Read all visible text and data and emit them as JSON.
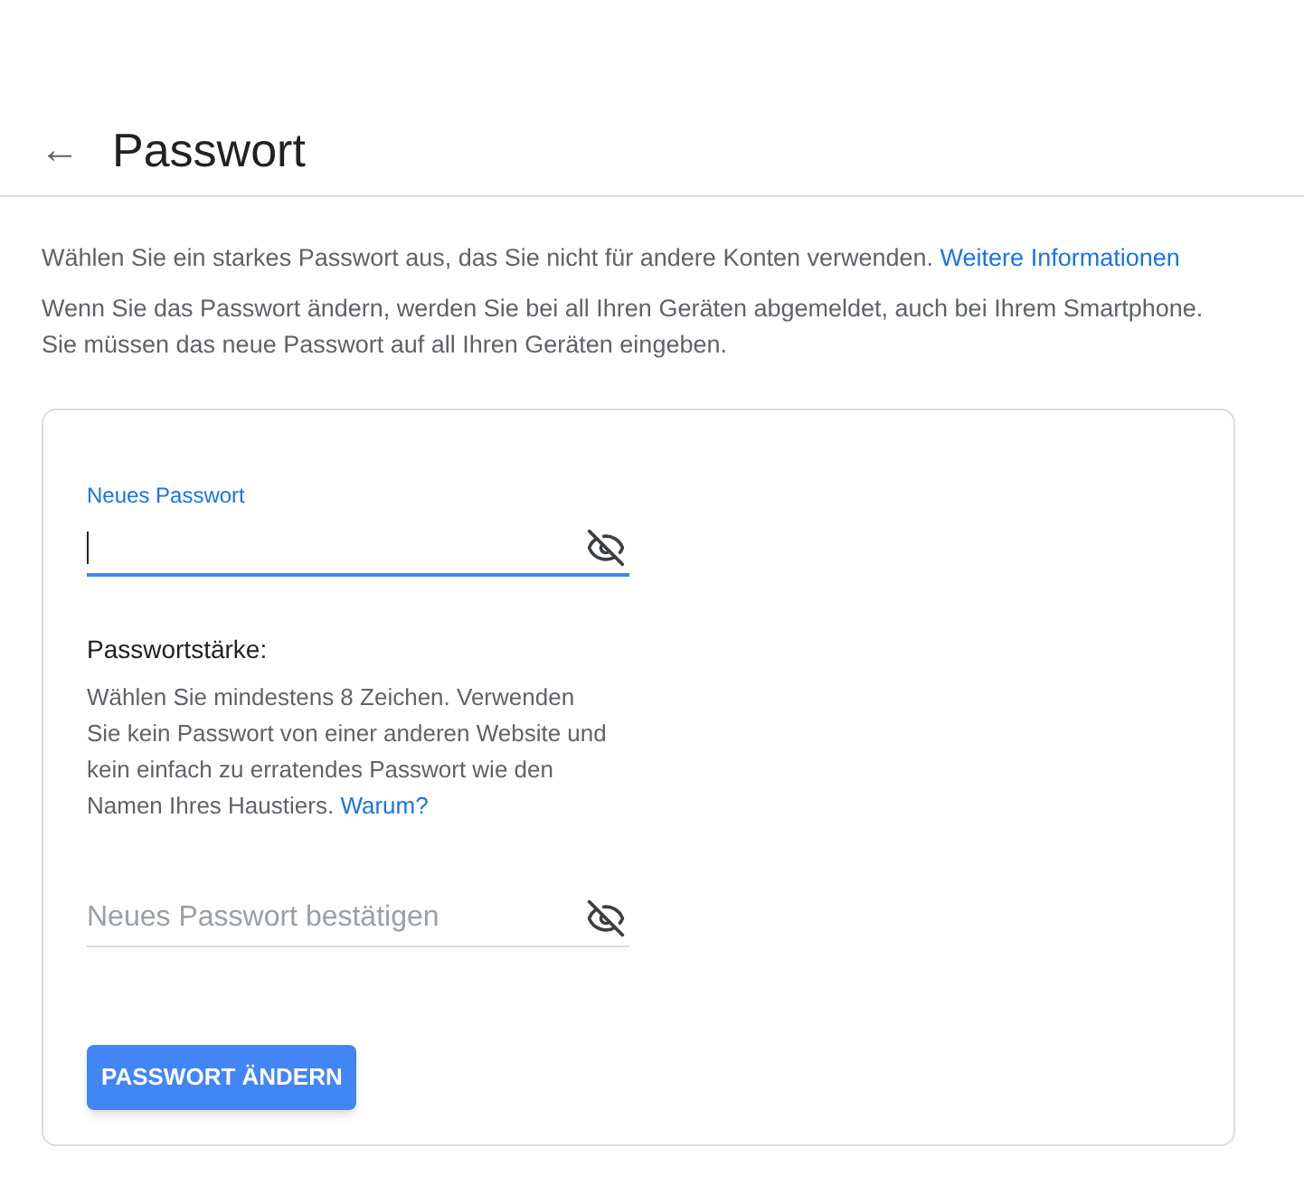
{
  "header": {
    "back": "←",
    "title": "Passwort"
  },
  "intro": [
    {
      "text": "Wählen Sie ein starkes Passwort aus, das Sie nicht für andere Konten verwenden.",
      "link": "Weitere Informationen"
    },
    {
      "text": "Wenn Sie das Passwort ändern, werden Sie bei all Ihren Geräten abgemeldet, auch bei Ihrem Smartphone. Sie müssen das neue Passwort auf all Ihren Geräten eingeben."
    }
  ],
  "new_password": {
    "label": "Neues Passwort",
    "focused": true
  },
  "strength": {
    "title": "Passwortstärke:",
    "text": "Wählen Sie mindestens 8 Zeichen. Verwenden Sie kein Passwort von einer anderen Website und kein einfach zu erratendes Passwort wie den Namen Ihres Haustiers.",
    "link": "Warum?"
  },
  "confirm_password": {
    "placeholder": "Neues Passwort bestätigen",
    "focused": false
  },
  "submit": "PASSWORT ÄNDERN"
}
